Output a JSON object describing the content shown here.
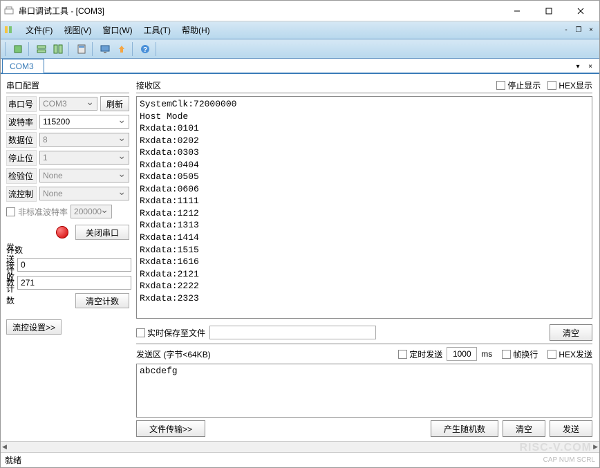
{
  "title": "串口调试工具 - [COM3]",
  "menus": {
    "file": "文件(F)",
    "view": "视图(V)",
    "window": "窗口(W)",
    "tool": "工具(T)",
    "help": "帮助(H)"
  },
  "tab": "COM3",
  "sidebar": {
    "config_title": "串口配置",
    "port_label": "串口号",
    "port_value": "COM3",
    "refresh": "刷新",
    "baud_label": "波特率",
    "baud_value": "115200",
    "databits_label": "数据位",
    "databits_value": "8",
    "stopbits_label": "停止位",
    "stopbits_value": "1",
    "parity_label": "检验位",
    "parity_value": "None",
    "flow_label": "流控制",
    "flow_value": "None",
    "nonstd_label": "非标准波特率",
    "nonstd_value": "200000",
    "close_port": "关闭串口",
    "count_title": "计数",
    "send_count_label": "发送计数",
    "send_count_value": "0",
    "recv_count_label": "接收计数",
    "recv_count_value": "271",
    "clear_count": "清空计数",
    "flow_settings": "流控设置>>"
  },
  "recv": {
    "title": "接收区",
    "stop_display": "停止显示",
    "hex_display": "HEX显示",
    "content": "SystemClk:72000000\nHost Mode\nRxdata:0101\nRxdata:0202\nRxdata:0303\nRxdata:0404\nRxdata:0505\nRxdata:0606\nRxdata:1111\nRxdata:1212\nRxdata:1313\nRxdata:1414\nRxdata:1515\nRxdata:1616\nRxdata:2121\nRxdata:2222\nRxdata:2323"
  },
  "save": {
    "realtime_label": "实时保存至文件",
    "clear": "清空"
  },
  "send": {
    "title": "发送区 (字节<64KB)",
    "timer_label": "定时发送",
    "timer_value": "1000",
    "timer_unit": "ms",
    "wrap_label": "帧换行",
    "hex_label": "HEX发送",
    "content": "abcdefg",
    "file_transfer": "文件传输>>",
    "gen_random": "产生随机数",
    "clear": "清空",
    "send_btn": "发送"
  },
  "status": {
    "ready": "就绪",
    "right": "CAP NUM SCRL"
  },
  "watermark": "RISC-V.COM"
}
